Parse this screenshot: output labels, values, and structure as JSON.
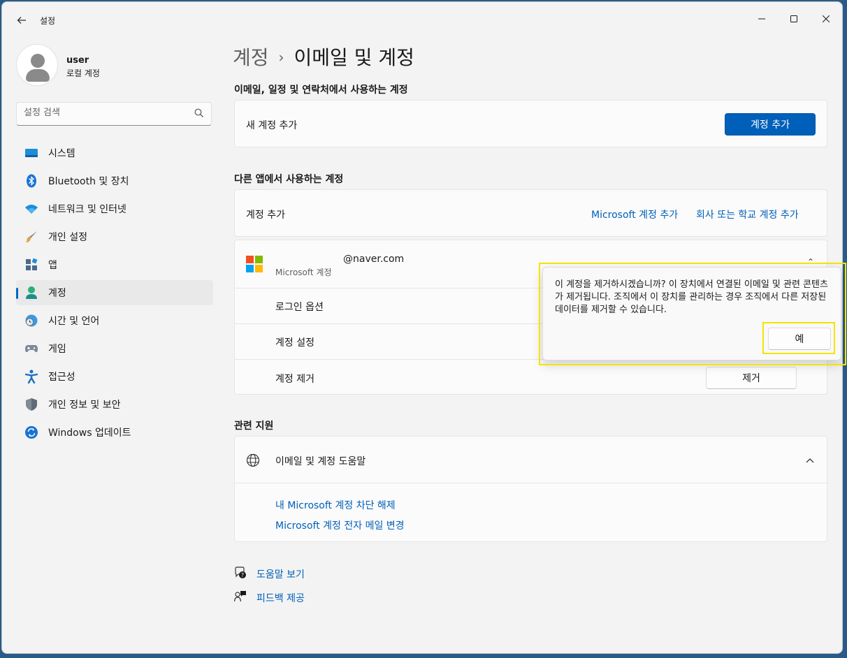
{
  "window": {
    "app_title": "설정",
    "back_label": "←",
    "minimize": "─",
    "maximize": "☐",
    "close": "✕"
  },
  "profile": {
    "name": "user",
    "account_type": "로컬 계정"
  },
  "search": {
    "placeholder": "설정 검색"
  },
  "sidebar": {
    "items": [
      {
        "label": "시스템",
        "icon": "system-icon"
      },
      {
        "label": "Bluetooth 및 장치",
        "icon": "bluetooth-icon"
      },
      {
        "label": "네트워크 및 인터넷",
        "icon": "wifi-icon"
      },
      {
        "label": "개인 설정",
        "icon": "paintbrush-icon"
      },
      {
        "label": "앱",
        "icon": "apps-icon"
      },
      {
        "label": "계정",
        "icon": "account-icon",
        "active": true
      },
      {
        "label": "시간 및 언어",
        "icon": "clock-globe-icon"
      },
      {
        "label": "게임",
        "icon": "gamepad-icon"
      },
      {
        "label": "접근성",
        "icon": "accessibility-icon"
      },
      {
        "label": "개인 정보 및 보안",
        "icon": "shield-icon"
      },
      {
        "label": "Windows 업데이트",
        "icon": "update-icon"
      }
    ]
  },
  "breadcrumb": {
    "parent": "계정",
    "separator": "›",
    "current": "이메일 및 계정"
  },
  "email_section": {
    "title": "이메일, 일정 및 연락처에서 사용하는 계정",
    "add_label": "새 계정 추가",
    "add_button": "계정 추가"
  },
  "other_apps_section": {
    "title": "다른 앱에서 사용하는 계정",
    "add_label": "계정 추가",
    "ms_link": "Microsoft 계정 추가",
    "work_link": "회사 또는 학교 계정 추가"
  },
  "account": {
    "email": "@naver.com",
    "type": "Microsoft 계정",
    "rows": [
      {
        "label": "로그인 옵션"
      },
      {
        "label": "계정 설정"
      },
      {
        "label": "계정 제거",
        "button": "제거"
      }
    ]
  },
  "flyout": {
    "message": "이 계정을 제거하시겠습니까? 이 장치에서 연결된 이메일 및 관련 콘텐츠가 제거됩니다. 조직에서 이 장치를 관리하는 경우 조직에서 다른 저장된 데이터를 제거할 수 있습니다.",
    "yes_button": "예"
  },
  "related": {
    "title": "관련 지원",
    "help_title": "이메일 및 계정 도움말",
    "links": [
      "내 Microsoft 계정 차단 해제",
      "Microsoft 계정 전자 메일 변경"
    ]
  },
  "footer": {
    "help": "도움말 보기",
    "feedback": "피드백 제공"
  },
  "colors": {
    "accent": "#005fb8",
    "highlight": "#f2e400"
  }
}
